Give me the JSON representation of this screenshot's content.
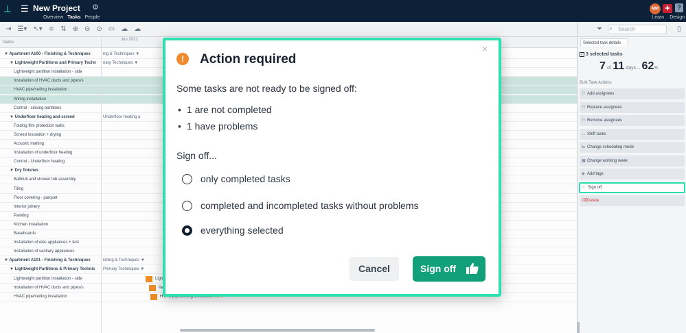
{
  "header": {
    "title": "New Project",
    "nav": [
      "Overview",
      "Tasks",
      "People"
    ],
    "active_nav": "Tasks",
    "avatar": "MM",
    "right_links": [
      "Learn",
      "Design"
    ]
  },
  "search": {
    "placeholder": "Search"
  },
  "gantt": {
    "name_header": "Name",
    "date_header": "Jun 2021",
    "rows": [
      {
        "label": "▼ Apartment A100 - Finishing & Techniques",
        "indent": 0,
        "bold": true,
        "extra": "ing & Techniques ▼"
      },
      {
        "label": "▼ Lightweight Partitions and Primary Techn",
        "indent": 1,
        "bold": true,
        "extra": "nary Techniques ▼"
      },
      {
        "label": "Lightweight partition installation - side",
        "indent": 2,
        "bold": false
      },
      {
        "label": "Installation of HVAC ducts and pipes/s",
        "indent": 2,
        "bold": false,
        "selected": true
      },
      {
        "label": "HVAC pipe/ceiling installation",
        "indent": 2,
        "bold": false,
        "selected": true
      },
      {
        "label": "Wiring installation",
        "indent": 2,
        "bold": false,
        "selected": true
      },
      {
        "label": "Control - closing partitions",
        "indent": 2,
        "bold": false
      },
      {
        "label": "▼ Underfloor heating and screed",
        "indent": 1,
        "bold": true,
        "extra": "Underfloor heating a"
      },
      {
        "label": "Folding film protection walls",
        "indent": 2,
        "bold": false
      },
      {
        "label": "Screed insulation + drying",
        "indent": 2,
        "bold": false
      },
      {
        "label": "Acoustic matting",
        "indent": 2,
        "bold": false
      },
      {
        "label": "Installation of underfloor heating",
        "indent": 2,
        "bold": false
      },
      {
        "label": "Control - Underfloor heating",
        "indent": 2,
        "bold": false
      },
      {
        "label": "▼ Dry finishes",
        "indent": 1,
        "bold": true
      },
      {
        "label": "Bathtub and shower tub assembly",
        "indent": 2,
        "bold": false
      },
      {
        "label": "Tiling",
        "indent": 2,
        "bold": false
      },
      {
        "label": "Floor covering - parquet",
        "indent": 2,
        "bold": false
      },
      {
        "label": "Interior joinery",
        "indent": 2,
        "bold": false
      },
      {
        "label": "Painting",
        "indent": 2,
        "bold": false
      },
      {
        "label": "Kitchen installation",
        "indent": 2,
        "bold": false
      },
      {
        "label": "Baseboards",
        "indent": 2,
        "bold": false
      },
      {
        "label": "Installation of elec appliances + test",
        "indent": 2,
        "bold": false
      },
      {
        "label": "Installation of sanitary appliances",
        "indent": 2,
        "bold": false
      },
      {
        "label": "▼ Apartment A101 - Finishing & Techniques",
        "indent": 0,
        "bold": true,
        "extra": "ishing & Techniques ▼"
      },
      {
        "label": "▼ Lightweight Partitions & Primary Technic",
        "indent": 1,
        "bold": true,
        "extra": "Primary Techniques ▼"
      },
      {
        "label": "Lightweight partition installation - side",
        "indent": 2,
        "bold": false,
        "bar": "Lightweight partition installation - side 1",
        "pct": "40%"
      },
      {
        "label": "Installation of HVAC ducts and pipes/s",
        "indent": 2,
        "bold": false,
        "bar": "llation of HVAC ducts and pipes/sanitary partition walls",
        "pct": "85%"
      },
      {
        "label": "HVAC pipe/ceiling installation",
        "indent": 2,
        "bold": false,
        "bar": "HVAC pipe/ceiling installation",
        "pct": "80%"
      }
    ]
  },
  "panel": {
    "tab": "Selected task details",
    "selected_label": "3 selected tasks",
    "days_done": "7",
    "days_of": "of",
    "days_total": "11",
    "days_unit": "days",
    "days_dash": "–",
    "percent": "62",
    "percent_sign": "%",
    "bulk_header": "Bulk Task Actions",
    "actions": [
      {
        "label": "Add assignees",
        "icon": "user-plus-icon"
      },
      {
        "label": "Replace assignees",
        "icon": "users-icon"
      },
      {
        "label": "Remove assignees",
        "icon": "user-minus-icon"
      },
      {
        "label": "Shift tasks",
        "icon": "arrows-icon"
      },
      {
        "label": "Change scheduling mode",
        "icon": "schedule-icon"
      },
      {
        "label": "Change working week",
        "icon": "calendar-icon"
      },
      {
        "label": "Add tags",
        "icon": "tag-icon"
      },
      {
        "label": "Sign off",
        "icon": "thumbs-up-icon",
        "highlighted": true
      },
      {
        "label": "Delete",
        "icon": "trash-icon",
        "danger": true
      }
    ]
  },
  "modal": {
    "title": "Action required",
    "message": "Some tasks are not ready to be signed off:",
    "issues": [
      "1 are not completed",
      "1 have problems"
    ],
    "sign_off_prompt": "Sign off...",
    "options": [
      {
        "label": "only completed tasks",
        "checked": false
      },
      {
        "label": "completed and incompleted tasks without problems",
        "checked": false
      },
      {
        "label": "everything selected",
        "checked": true
      }
    ],
    "cancel_label": "Cancel",
    "confirm_label": "Sign off",
    "close_glyph": "×",
    "warn_glyph": "!"
  },
  "colors": {
    "accent": "#2de0b0",
    "confirm": "#12a07a",
    "warning": "#f28b2c",
    "topbar": "#0d2238",
    "bar": "#f18e2a"
  }
}
